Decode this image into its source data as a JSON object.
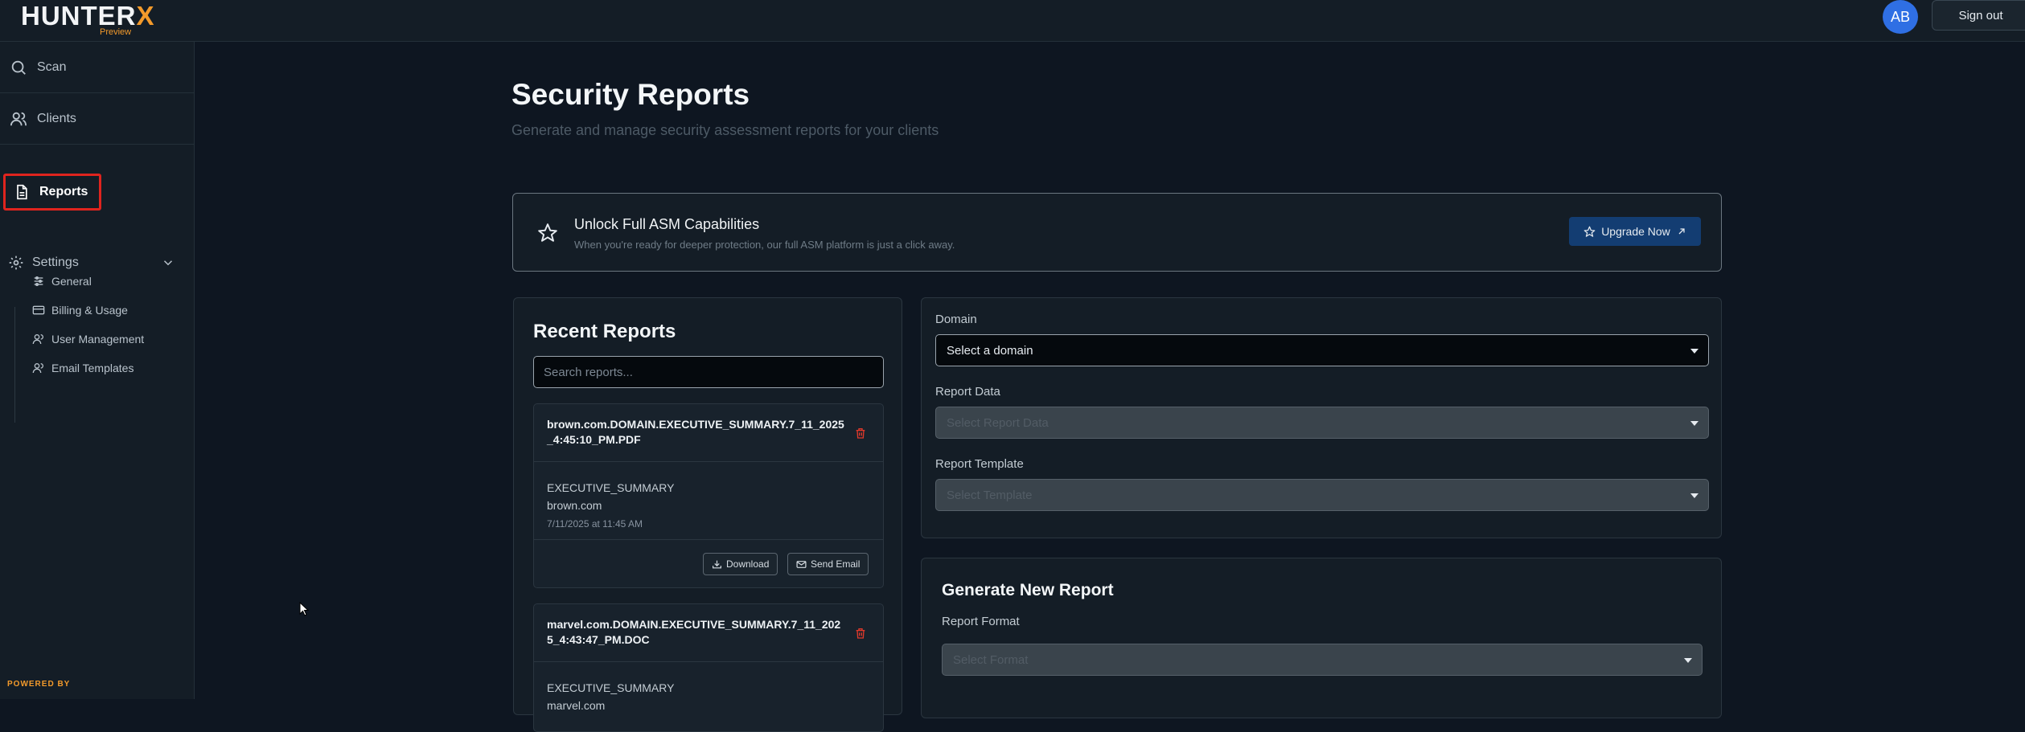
{
  "app": {
    "logo_text": "HUNTER",
    "logo_x": "X",
    "logo_sub": "Preview",
    "user_initials": "AB",
    "sign_out": "Sign out",
    "powered_by": "POWERED BY"
  },
  "sidebar": {
    "items": [
      {
        "label": "Scan",
        "icon": "search-icon"
      },
      {
        "label": "Clients",
        "icon": "users-icon"
      },
      {
        "label": "Reports",
        "icon": "document-icon",
        "active": true
      },
      {
        "label": "Settings",
        "icon": "gear-icon"
      }
    ],
    "settings_sub": [
      {
        "label": "General",
        "icon": "sliders-icon"
      },
      {
        "label": "Billing & Usage",
        "icon": "credit-card-icon"
      },
      {
        "label": "User Management",
        "icon": "users-icon"
      },
      {
        "label": "Email Templates",
        "icon": "users-icon"
      }
    ]
  },
  "page": {
    "title": "Security Reports",
    "subtitle": "Generate and manage security assessment reports for your clients"
  },
  "banner": {
    "title": "Unlock Full ASM Capabilities",
    "subtitle": "When you're ready for deeper protection, our full ASM platform is just a click away.",
    "button": "Upgrade Now"
  },
  "recent": {
    "title": "Recent Reports",
    "search_placeholder": "Search reports...",
    "reports": [
      {
        "name": "brown.com.DOMAIN.EXECUTIVE_SUMMARY.7_11_2025_4:45:10_PM.PDF",
        "type": "EXECUTIVE_SUMMARY",
        "domain": "brown.com",
        "date": "7/11/2025 at 11:45 AM",
        "download": "Download",
        "send_email": "Send Email"
      },
      {
        "name": "marvel.com.DOMAIN.EXECUTIVE_SUMMARY.7_11_2025_4:43:47_PM.DOC",
        "type": "EXECUTIVE_SUMMARY",
        "domain": "marvel.com"
      }
    ]
  },
  "form": {
    "domain_label": "Domain",
    "domain_value": "Select a domain",
    "report_data_label": "Report Data",
    "report_data_placeholder": "Select Report Data",
    "template_label": "Report Template",
    "template_placeholder": "Select Template"
  },
  "generate": {
    "title": "Generate New Report",
    "format_label": "Report Format",
    "format_placeholder": "Select Format"
  }
}
